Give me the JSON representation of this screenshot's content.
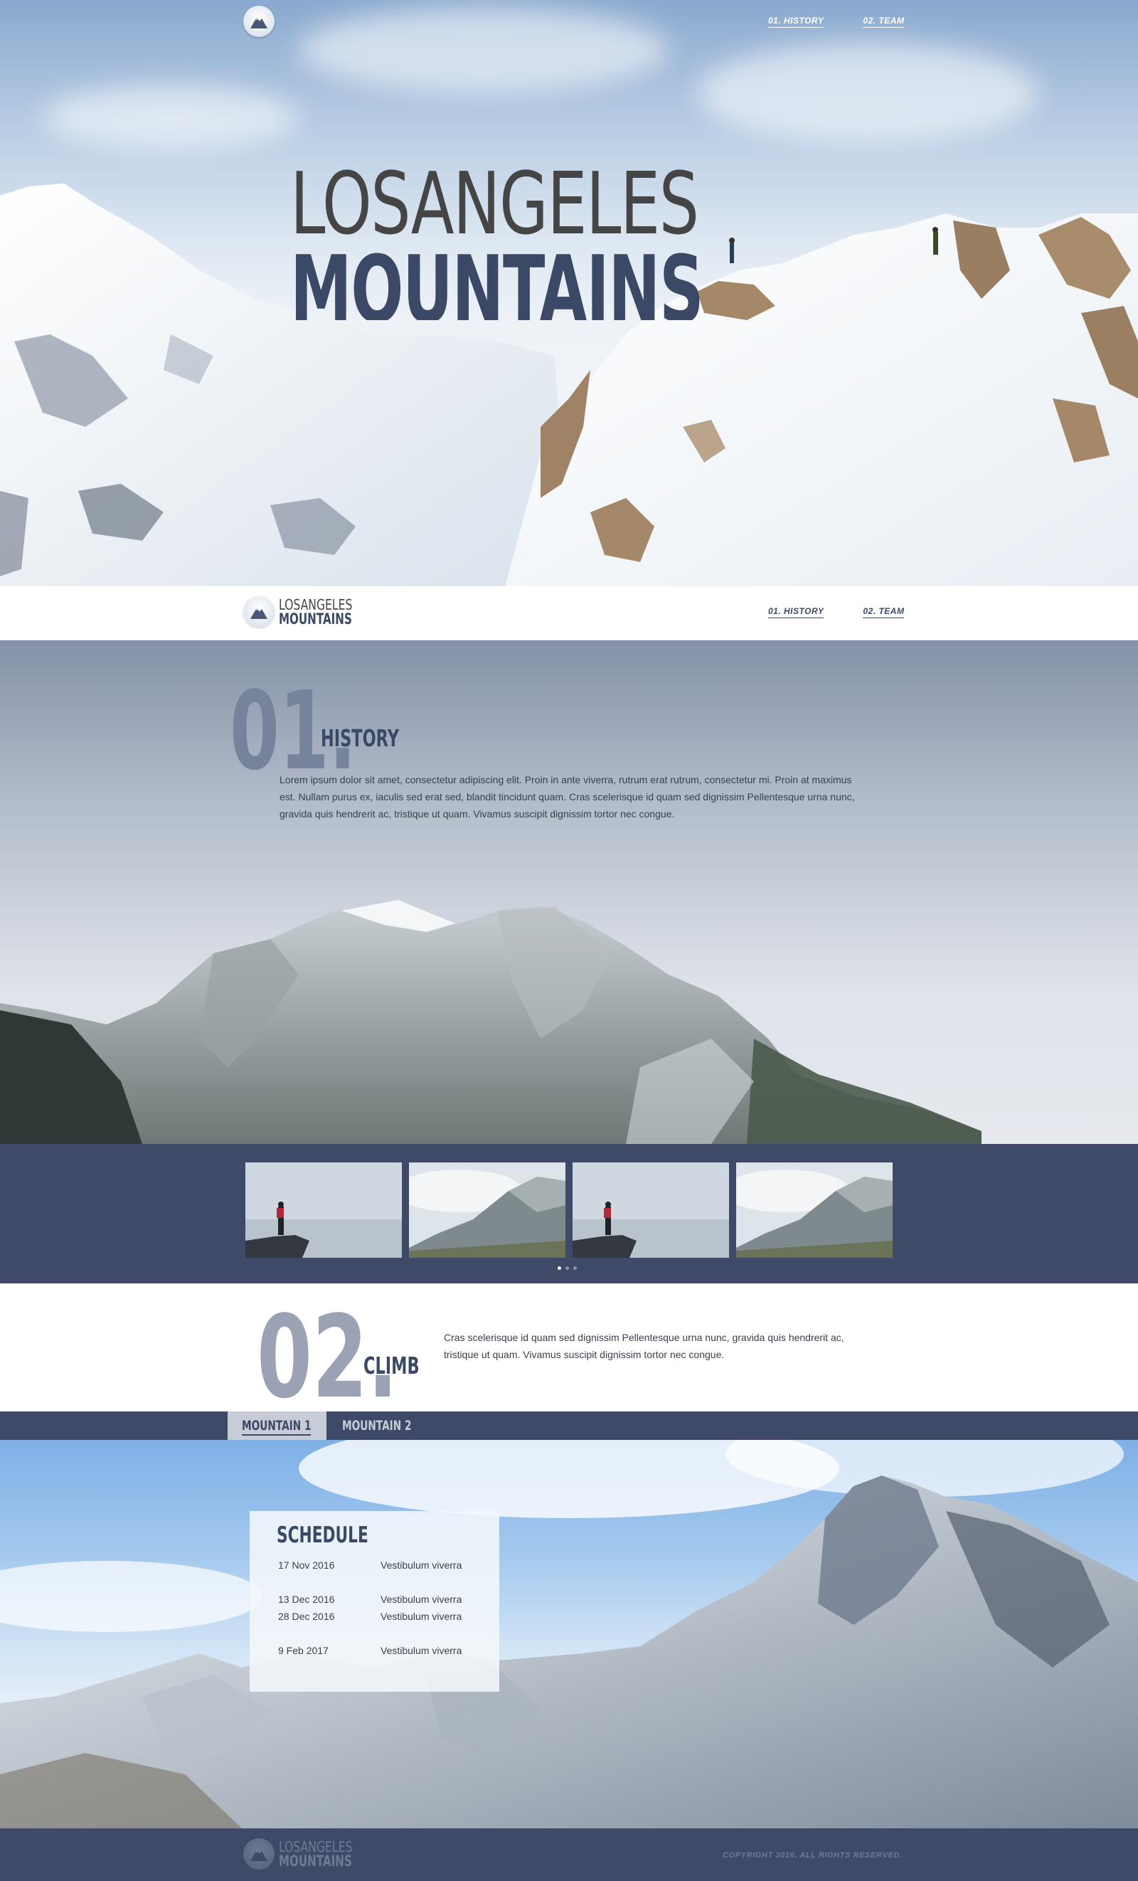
{
  "hero": {
    "title_line1": "LOSANGELES",
    "title_line2": "MOUNTAINS",
    "nav": [
      {
        "label": "01. HISTORY"
      },
      {
        "label": "02. TEAM"
      }
    ]
  },
  "navbar": {
    "brand_line1": "LOSANGELES",
    "brand_line2": "MOUNTAINS",
    "nav": [
      {
        "label": "01. HISTORY"
      },
      {
        "label": "02. TEAM"
      }
    ]
  },
  "history": {
    "number": "01.",
    "title": "HISTORY",
    "body": "Lorem ipsum dolor sit amet, consectetur adipiscing elit. Proin in ante viverra, rutrum erat rutrum, consectetur mi. Proin at maximus est. Nullam purus ex, iaculis sed erat sed, blandit tincidunt quam. Cras scelerisque id quam sed dignissim Pellentesque urna nunc, gravida quis hendrerit ac, tristique ut quam. Vivamus suscipit dignissim tortor nec congue."
  },
  "gallery": {
    "thumbnails": [
      "hiker-on-rock",
      "misty-valley",
      "hiker-on-rock",
      "misty-valley"
    ],
    "dots": 3,
    "active_dot": 0
  },
  "climb": {
    "number": "02.",
    "title": "CLIMB",
    "body": "Cras scelerisque id quam sed dignissim Pellentesque urna nunc, gravida quis hendrerit ac, tristique ut quam. Vivamus suscipit dignissim tortor nec congue."
  },
  "tabs": [
    {
      "label": "MOUNTAIN 1",
      "active": true
    },
    {
      "label": "MOUNTAIN 2",
      "active": false
    }
  ],
  "schedule": {
    "title": "SCHEDULE",
    "rows": [
      {
        "date": "17 Nov 2016",
        "text": "Vestibulum viverra"
      },
      {
        "date": "13 Dec 2016",
        "text": "Vestibulum viverra"
      },
      {
        "date": "28 Dec 2016",
        "text": "Vestibulum viverra"
      },
      {
        "date": "9 Feb 2017",
        "text": "Vestibulum viverra"
      }
    ]
  },
  "footer": {
    "brand_line1": "LOSANGELES",
    "brand_line2": "MOUNTAINS",
    "copyright": "COPYRIGHT 2016. ALL RIGHTS RESERVED."
  },
  "colors": {
    "navy": "#3e4a68",
    "title_dark": "#454545",
    "title_navy": "#3b4866",
    "tab_active_bg": "#c7ccd6"
  },
  "icons": [
    "mountain-logo-icon"
  ]
}
